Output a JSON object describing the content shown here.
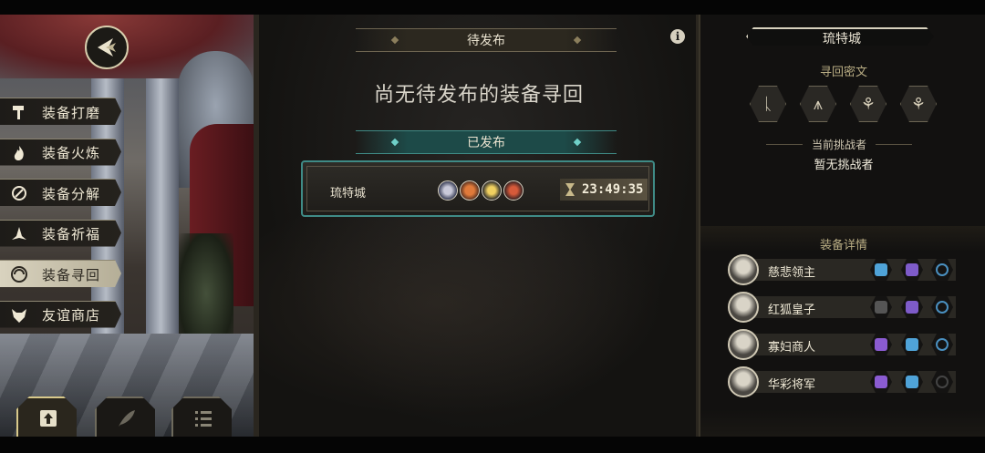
{
  "menu": {
    "items": [
      {
        "label": "装备打磨",
        "icon": "hammer-icon",
        "active": false
      },
      {
        "label": "装备火炼",
        "icon": "flame-icon",
        "active": false
      },
      {
        "label": "装备分解",
        "icon": "disassemble-icon",
        "active": false
      },
      {
        "label": "装备祈福",
        "icon": "pray-icon",
        "active": false
      },
      {
        "label": "装备寻回",
        "icon": "retrieve-icon",
        "active": true
      },
      {
        "label": "友谊商店",
        "icon": "fox-shop-icon",
        "active": false
      }
    ]
  },
  "center": {
    "pending_title": "待发布",
    "empty_message": "尚无待发布的装备寻回",
    "published_title": "已发布",
    "quest": {
      "city": "琉特城",
      "timer": "23:49:35"
    }
  },
  "right": {
    "city": "琉特城",
    "code_title": "寻回密文",
    "codes": [
      "ᚳ",
      "⩚",
      "⚘",
      "⚘"
    ],
    "challenger_label": "当前挑战者",
    "challenger_value": "暂无挑战者",
    "details_title": "装备详情",
    "equipment": [
      {
        "name": "慈悲领主",
        "slots": [
          "#4fa3d8",
          "#7e5bc9",
          "#4a90c0"
        ]
      },
      {
        "name": "红狐皇子",
        "slots": [
          "#555555",
          "#7e5bc9",
          "#4a90c0"
        ]
      },
      {
        "name": "寡妇商人",
        "slots": [
          "#8a5bd1",
          "#4fa3d8",
          "#4a90c0"
        ]
      },
      {
        "name": "华彩将军",
        "slots": [
          "#8a5bd1",
          "#4fa3d8",
          "#444444"
        ]
      }
    ]
  },
  "colors": {
    "accent_teal": "#3f8b86",
    "gold": "#d8c98b"
  }
}
